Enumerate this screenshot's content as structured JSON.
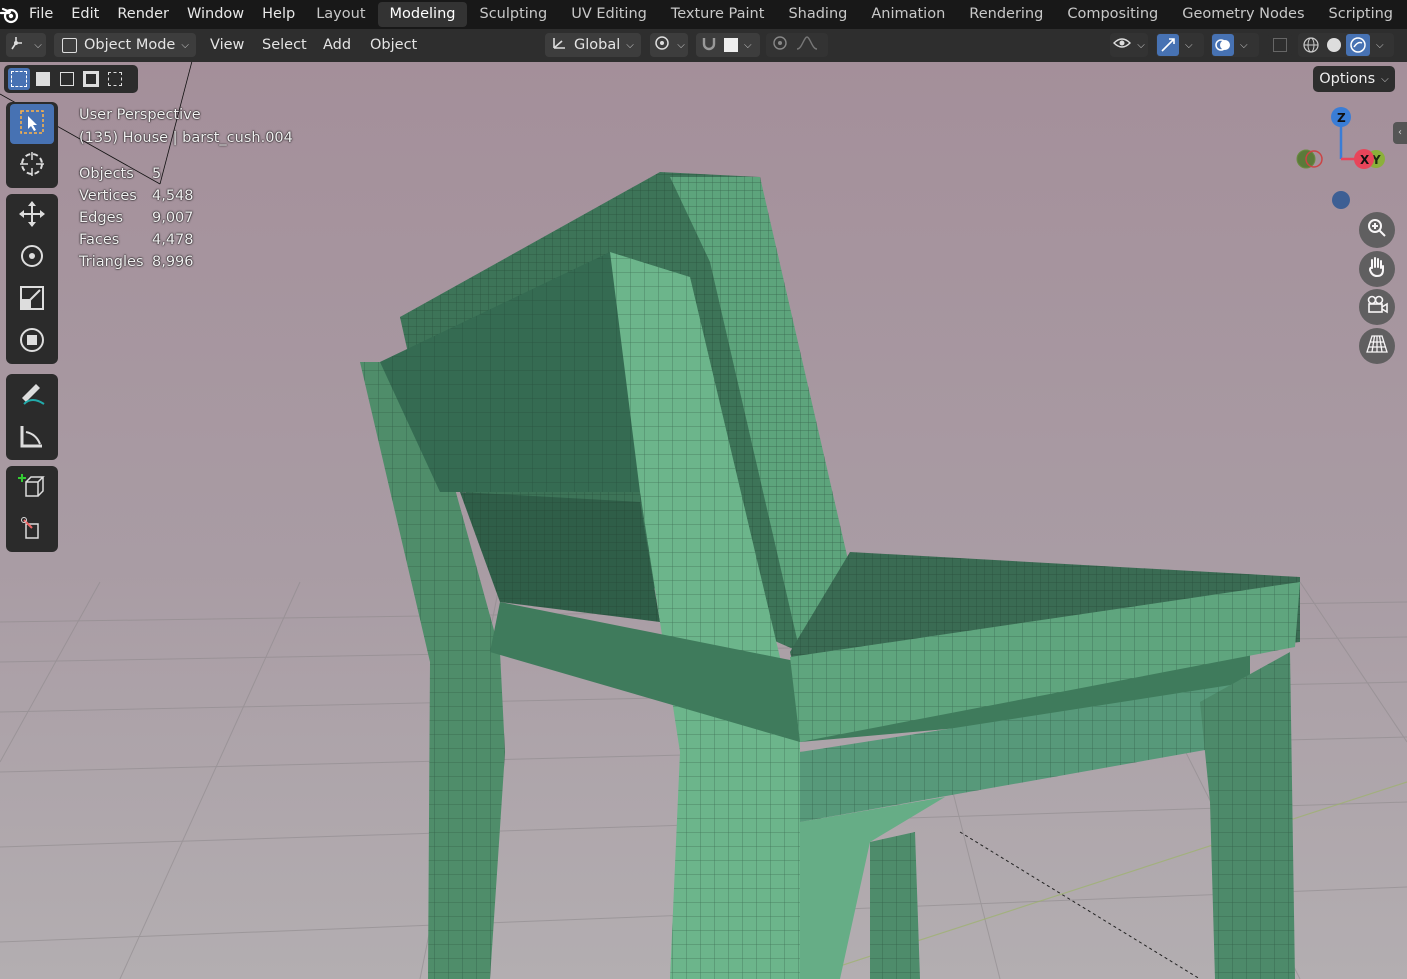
{
  "menubar": {
    "items": [
      "File",
      "Edit",
      "Render",
      "Window",
      "Help"
    ],
    "workspaces": [
      "Layout",
      "Modeling",
      "Sculpting",
      "UV Editing",
      "Texture Paint",
      "Shading",
      "Animation",
      "Rendering",
      "Compositing",
      "Geometry Nodes",
      "Scripting"
    ],
    "active_workspace": "Modeling"
  },
  "header": {
    "mode": "Object Mode",
    "menus": [
      "View",
      "Select",
      "Add",
      "Object"
    ],
    "orientation": "Global"
  },
  "viewport": {
    "view_name": "User Perspective",
    "object_info": "(135) House | barst_cush.004",
    "stats": [
      {
        "label": "Objects",
        "value": "5"
      },
      {
        "label": "Vertices",
        "value": "4,548"
      },
      {
        "label": "Edges",
        "value": "9,007"
      },
      {
        "label": "Faces",
        "value": "4,478"
      },
      {
        "label": "Triangles",
        "value": "8,996"
      }
    ],
    "options_label": "Options",
    "gizmo": {
      "z": "Z",
      "x": "X",
      "y": "Y"
    }
  },
  "colors": {
    "accent": "#4772b3",
    "mesh": "#5fa07c",
    "background": "#a99ca4"
  }
}
